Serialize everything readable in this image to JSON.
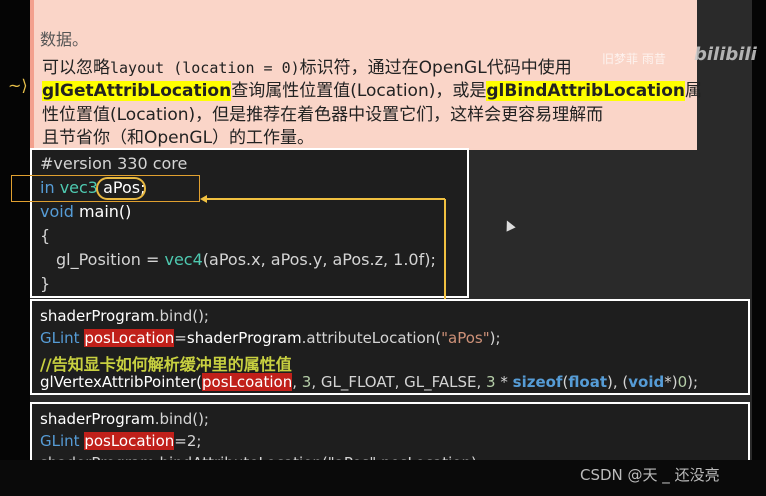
{
  "note": {
    "top_fragment": "数据。",
    "line1_a": "可以忽略",
    "line1_code": "layout (location = 0)",
    "line1_b": "标识符，通过在OpenGL代码中使用",
    "line2_hl1": "glGetAttribLocation",
    "line2_mid": "查询属性位置值(Location)，或是",
    "line2_hl2": "glBindAttribLocation",
    "line2_end": "属",
    "line3": "性位置值(Location)，但是推荐在着色器中设置它们，这样会更容易理解而",
    "line4": "且节省你（和OpenGL）的工作量。"
  },
  "shader": {
    "l1": "#version 330 core",
    "l2_kw": "in",
    "l2_ty": "vec3",
    "l2_var": "aPos;",
    "l3_kw": "void",
    "l3_fn": "main()",
    "l4": "{",
    "l5_a": "gl_Position = ",
    "l5_ty": "vec4",
    "l5_b": "(aPos.x, aPos.y, aPos.z, 1.0f);",
    "l6": "}"
  },
  "code2": {
    "l1_obj": "shaderProgram",
    "l1_rest": ".bind();",
    "l2_ty": "GLint",
    "l2_hl": "posLocation",
    "l2_eq": "=",
    "l2_obj": "shaderProgram",
    "l2_rest": ".attributeLocation(",
    "l2_str": "\"aPos\"",
    "l2_end": ");",
    "l3_comment": "//告知显卡如何解析缓冲里的属性值",
    "l4_fn": "glVertexAttribPointer(",
    "l4_hl": "posLcoation",
    "l4_a": ", ",
    "l4_n3": "3",
    "l4_b": ", GL_FLOAT, GL_FALSE, ",
    "l4_n3b": "3",
    "l4_c": " * ",
    "l4_kw": "sizeof",
    "l4_d": "(",
    "l4_kw2": "float",
    "l4_e": "), (",
    "l4_kw3": "void",
    "l4_f": "*)",
    "l4_zero": "0",
    "l4_g": ");"
  },
  "code3": {
    "l1_obj": "shaderProgram",
    "l1_rest": ".bind();",
    "l2_ty": "GLint",
    "l2_hl": "posLocation",
    "l2_rest": "=2;",
    "l3": "shaderProgram.bindAttributeLocation(\"aPos\",posLocation);"
  },
  "overlay": {
    "bilibili": "bilibili",
    "uploader_text": "旧梦菲 雨昔",
    "csdn": "CSDN @天 _ 还没亮"
  }
}
